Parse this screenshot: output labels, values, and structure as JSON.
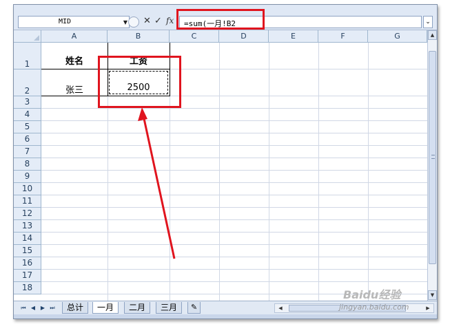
{
  "formula_bar": {
    "name_box": "MID",
    "cancel_glyph": "✕",
    "enter_glyph": "✓",
    "fx_label": "fx",
    "formula_text": "=sum(一月!B2"
  },
  "columns": [
    "A",
    "B",
    "C",
    "D",
    "E",
    "F",
    "G"
  ],
  "rows": [
    "1",
    "2",
    "3",
    "4",
    "5",
    "6",
    "7",
    "8",
    "9",
    "10",
    "11",
    "12",
    "13",
    "14",
    "15",
    "16",
    "17",
    "18"
  ],
  "cells": {
    "A1": "姓名",
    "B1": "工资",
    "A2": "张三",
    "B2": "2500"
  },
  "sheet_tabs": {
    "items": [
      "总计",
      "一月",
      "二月",
      "三月"
    ],
    "active": "一月"
  },
  "watermark": {
    "logo": "Baidu经验",
    "url": "jingyan.baidu.com"
  },
  "colors": {
    "annotation_red": "#e0141e",
    "header_bg": "#e4ecf7",
    "gridline": "#d0d7e5"
  },
  "icons": [
    "dropdown-arrow-icon",
    "cancel-icon",
    "enter-icon",
    "fx-icon",
    "expand-icon",
    "scroll-arrow-icon",
    "insert-sheet-icon"
  ]
}
